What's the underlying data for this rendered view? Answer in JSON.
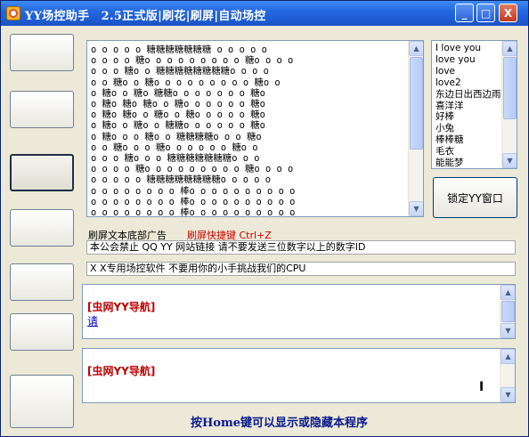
{
  "window": {
    "title": "YY场控助手　2.5正式版|刷花|刷屏|自动场控",
    "controls": {
      "minimize": "_",
      "maximize": "□",
      "close": "X"
    }
  },
  "pattern": {
    "lines": [
      "o o o o o 糖糖糖糖糖糖糖 o o o o o",
      "o o o o 糖o o o o o o o o o 糖o o o o",
      "o o o 糖o o 糖糖糖糖糖糖糖糖o o o o",
      "o o 糖o o 糖o o o o o o o o o 糖o o",
      "o 糖o o 糖o 糖糖o o o o o o o 糖o",
      "o 糖o 糖o 糖o o 糖o o o o o o 糖o",
      "o 糖o 糖o o 糖o o 糖o o o o o 糖o",
      "o 糖o o 糖o o 糖糖o o o o o o 糖o",
      "o 糖o o o 糖o o 糖糖糖糖o o o 糖o",
      "o o 糖o o o 糖o o o o o o 糖o o",
      "o o o 糖o o o 糖糖糖糖糖糖糖o o o",
      "o o o o 糖o o o o o o o o o 糖o o o o",
      "o o o o o 糖糖糖糖糖糖糖糖o o o o o",
      "o o o o o o o o 棒o o o o o o o o o o",
      "o o o o o o o o 棒o o o o o o o o o o",
      "o o o o o o o o 棒o o o o o o o o o o",
      "o o o o o o o o 棒o o o o o o o o o o"
    ]
  },
  "names": {
    "items": [
      "I love you",
      "love you",
      "love",
      "love2",
      "东边日出西边雨",
      "喜洋洋",
      "好棒",
      "小兔",
      "棒棒糖",
      "毛衣",
      "能能梦"
    ]
  },
  "lock_button": {
    "label": "锁定YY窗口"
  },
  "labels": {
    "ad": "刷屏文本底部广告",
    "hotkey": "刷屏快捷键 Ctrl+Z"
  },
  "notices": {
    "line1": "本公会禁止 QQ YY 网站链接 请不要发送三位数字以上的数字ID",
    "line2": "X X专用场控软件 不要用你的小手挑战我们的CPU"
  },
  "chat1": {
    "title": "[虫网YY导航]",
    "link": "请"
  },
  "chat2": {
    "title": "[虫网YY导航]",
    "caret": "I"
  },
  "footer": {
    "note": "按Home键可以显示或隐藏本程序"
  },
  "colors": {
    "title_bar": "#2468e0",
    "hotkey_label": "#cc0000",
    "chat_title": "#c00000",
    "footer_note": "#0a1a8c"
  },
  "icons": [
    "app-icon",
    "scroll-up-arrow-icon",
    "scroll-down-arrow-icon"
  ]
}
